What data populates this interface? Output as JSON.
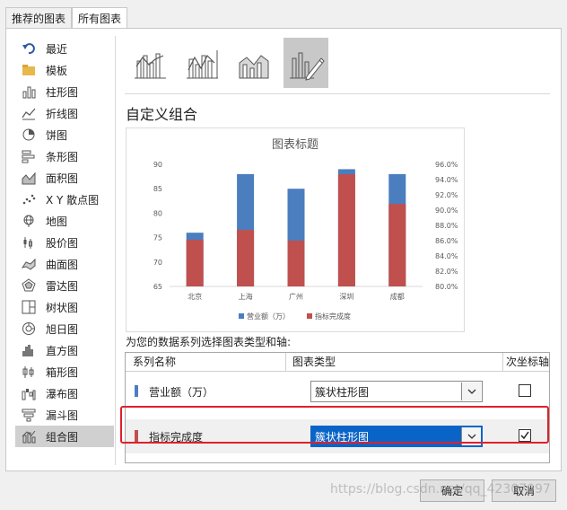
{
  "tabs": [
    {
      "label": "推荐的图表",
      "active": false
    },
    {
      "label": "所有图表",
      "active": true
    }
  ],
  "sidebar": {
    "items": [
      {
        "label": "最近",
        "icon": "undo-arrow-icon"
      },
      {
        "label": "模板",
        "icon": "folder-icon"
      },
      {
        "label": "柱形图",
        "icon": "column-chart-icon"
      },
      {
        "label": "折线图",
        "icon": "line-chart-icon"
      },
      {
        "label": "饼图",
        "icon": "pie-chart-icon"
      },
      {
        "label": "条形图",
        "icon": "bar-chart-icon"
      },
      {
        "label": "面积图",
        "icon": "area-chart-icon"
      },
      {
        "label": "X Y 散点图",
        "icon": "scatter-chart-icon"
      },
      {
        "label": "地图",
        "icon": "globe-icon"
      },
      {
        "label": "股价图",
        "icon": "stock-chart-icon"
      },
      {
        "label": "曲面图",
        "icon": "surface-chart-icon"
      },
      {
        "label": "雷达图",
        "icon": "radar-chart-icon"
      },
      {
        "label": "树状图",
        "icon": "treemap-icon"
      },
      {
        "label": "旭日图",
        "icon": "sunburst-icon"
      },
      {
        "label": "直方图",
        "icon": "histogram-icon"
      },
      {
        "label": "箱形图",
        "icon": "box-whisker-icon"
      },
      {
        "label": "瀑布图",
        "icon": "waterfall-icon"
      },
      {
        "label": "漏斗图",
        "icon": "funnel-icon"
      },
      {
        "label": "组合图",
        "icon": "combo-chart-icon",
        "selected": true
      }
    ]
  },
  "custom_title": "自定义组合",
  "chart_data": {
    "type": "bar",
    "title": "图表标题",
    "categories": [
      "北京",
      "上海",
      "广州",
      "深圳",
      "成都"
    ],
    "series": [
      {
        "name": "营业额（万）",
        "values": [
          76,
          88,
          85,
          89,
          88
        ],
        "color": "#4a7ebf",
        "axis": "primary"
      },
      {
        "name": "指标完成度",
        "values": [
          0.861,
          0.874,
          0.86,
          0.947,
          0.908
        ],
        "color": "#c0504d",
        "axis": "secondary"
      }
    ],
    "ylim": [
      65,
      90
    ],
    "yticks": [
      "90",
      "85",
      "80",
      "75",
      "70",
      "65"
    ],
    "y2lim": [
      0.8,
      0.96
    ],
    "y2ticks": [
      "96.0%",
      "94.0%",
      "92.0%",
      "90.0%",
      "88.0%",
      "86.0%",
      "84.0%",
      "82.0%",
      "80.0%"
    ],
    "legend": "bottom",
    "grid": false
  },
  "prompt": "为您的数据系列选择图表类型和轴:",
  "table": {
    "headers": [
      "系列名称",
      "图表类型",
      "次坐标轴"
    ],
    "rows": [
      {
        "name": "营业额（万）",
        "type": "簇状柱形图",
        "secondary": false,
        "color": "#4a7ebf",
        "active": false
      },
      {
        "name": "指标完成度",
        "type": "簇状柱形图",
        "secondary": true,
        "color": "#c0504d",
        "active": true
      }
    ]
  },
  "buttons": {
    "ok": "确定",
    "cancel": "取消"
  },
  "watermark": "https://blog.csdn.net/qq_42307097"
}
